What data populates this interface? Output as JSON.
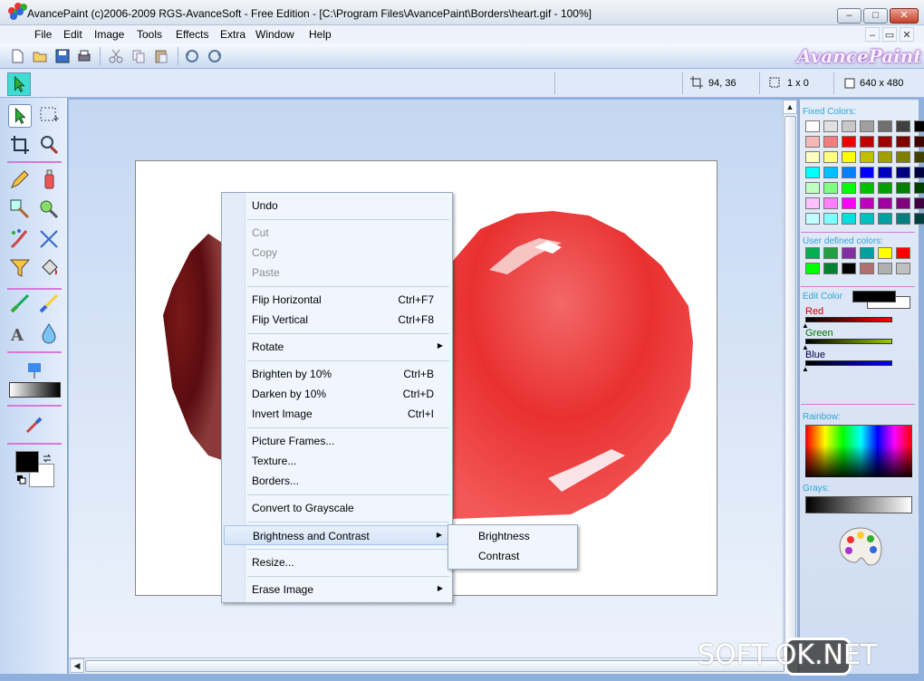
{
  "window": {
    "title": "AvancePaint (c)2006-2009 RGS-AvanceSoft - Free Edition - [C:\\Program Files\\AvancePaint\\Borders\\heart.gif - 100%]",
    "minimize": "–",
    "maximize": "□",
    "close": "✕"
  },
  "mdi": {
    "minimize": "–",
    "restore": "▭",
    "close": "✕"
  },
  "menu": {
    "items": [
      "File",
      "Edit",
      "Image",
      "Tools",
      "Effects",
      "Extra",
      "Window",
      "Help"
    ]
  },
  "logo": "AvancePaint",
  "status": {
    "cursor_pos": "94, 36",
    "selection_size": "1 x 0",
    "image_size": "640 x 480"
  },
  "context_menu": {
    "undo": "Undo",
    "cut": "Cut",
    "copy": "Copy",
    "paste": "Paste",
    "flip_h": "Flip Horizontal",
    "flip_h_sc": "Ctrl+F7",
    "flip_v": "Flip Vertical",
    "flip_v_sc": "Ctrl+F8",
    "rotate": "Rotate",
    "brighten": "Brighten by 10%",
    "brighten_sc": "Ctrl+B",
    "darken": "Darken by 10%",
    "darken_sc": "Ctrl+D",
    "invert": "Invert Image",
    "invert_sc": "Ctrl+I",
    "frames": "Picture Frames...",
    "texture": "Texture...",
    "borders": "Borders...",
    "grayscale": "Convert to Grayscale",
    "brightness_contrast": "Brightness and Contrast",
    "resize": "Resize...",
    "erase": "Erase Image"
  },
  "submenu": {
    "brightness": "Brightness",
    "contrast": "Contrast"
  },
  "panel": {
    "fixed_colors_label": "Fixed Colors:",
    "user_colors_label": "User defined colors:",
    "edit_color_label": "Edit Color",
    "red_label": "Red",
    "green_label": "Green",
    "blue_label": "Blue",
    "rainbow_label": "Rainbow:",
    "grays_label": "Grays:",
    "fixed_colors": [
      [
        "#ffffff",
        "#e0e0e0",
        "#c8c8c8",
        "#a0a0a0",
        "#707070",
        "#404040",
        "#000000"
      ],
      [
        "#f4b8b8",
        "#f08080",
        "#f00000",
        "#c00000",
        "#a00000",
        "#800000",
        "#400000"
      ],
      [
        "#ffffc0",
        "#ffff80",
        "#ffff00",
        "#c0c000",
        "#a0a000",
        "#808000",
        "#404000"
      ],
      [
        "#00ffff",
        "#00c0ff",
        "#0080ff",
        "#0000ff",
        "#0000c0",
        "#000080",
        "#000040"
      ],
      [
        "#c0ffc0",
        "#80ff80",
        "#00ff00",
        "#00c000",
        "#00a000",
        "#008000",
        "#004000"
      ],
      [
        "#ffc0ff",
        "#ff80ff",
        "#ff00ff",
        "#c000c0",
        "#a000a0",
        "#800080",
        "#400040"
      ],
      [
        "#c0ffff",
        "#80ffff",
        "#00e0e0",
        "#00c0c0",
        "#00a0a0",
        "#008080",
        "#004040"
      ]
    ],
    "user_colors": [
      [
        "#00b050",
        "#20a040",
        "#8030a0",
        "#00a0a0",
        "#ffff00",
        "#ff0000"
      ],
      [
        "#00ff00",
        "#008030",
        "#000000",
        "#b07070",
        "#b0b0b0",
        "#c0c0c0"
      ]
    ],
    "primary_color": "#000000",
    "secondary_color": "#ffffff"
  },
  "watermark": {
    "left": "SOFT",
    "box": "OK",
    "right": ".NET"
  }
}
